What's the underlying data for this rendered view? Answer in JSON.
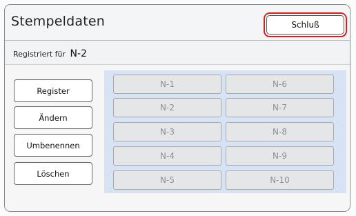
{
  "header": {
    "title": "Stempeldaten",
    "close_label": "Schluß"
  },
  "registration": {
    "label": "Registriert für",
    "value": "N-2"
  },
  "actions": [
    {
      "label": "Register"
    },
    {
      "label": "Ändern"
    },
    {
      "label": "Umbenennen"
    },
    {
      "label": "Löschen"
    }
  ],
  "slots": {
    "left": [
      "N-1",
      "N-2",
      "N-3",
      "N-4",
      "N-5"
    ],
    "right": [
      "N-6",
      "N-7",
      "N-8",
      "N-9",
      "N-10"
    ]
  },
  "colors": {
    "close_highlight": "#e01a1a",
    "grid_background": "#d7e3f4",
    "slot_disabled_text": "#8e9093"
  }
}
